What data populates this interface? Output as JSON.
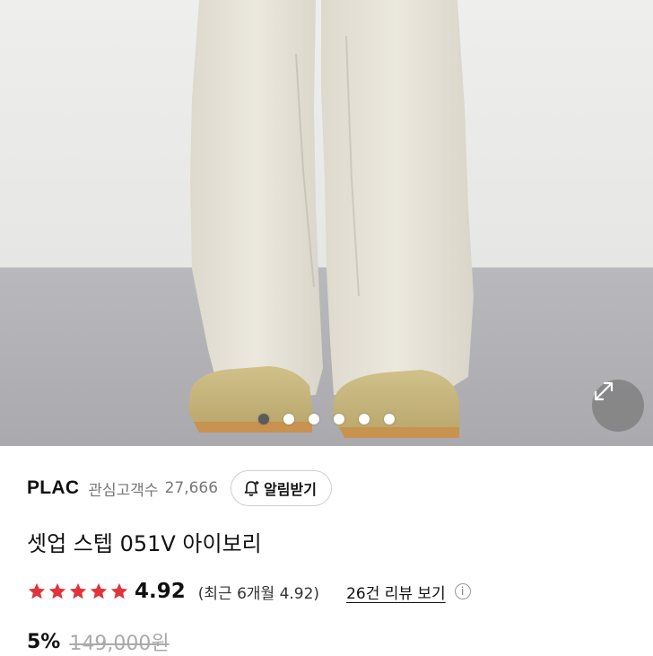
{
  "product_image": {
    "description_icon": "product-photo",
    "carousel_dot_count": 6,
    "active_dot_index": 0
  },
  "expand_button": {
    "icon": "expand-arrows-icon"
  },
  "brand": {
    "name": "PLAC",
    "followers_label": "관심고객수",
    "followers_count": "27,666",
    "alert_button_label": "알림받기",
    "alert_icon": "bell-plus-icon"
  },
  "product": {
    "title": "셋업 스텝 051V 아이보리"
  },
  "rating": {
    "stars": 5,
    "value": "4.92",
    "recent": "(최근 6개월 4.92)",
    "reviews_link": "26건 리뷰 보기",
    "info_icon": "i",
    "star_color": "#e0343a"
  },
  "price": {
    "discount": "5%",
    "original": "149,000원"
  }
}
